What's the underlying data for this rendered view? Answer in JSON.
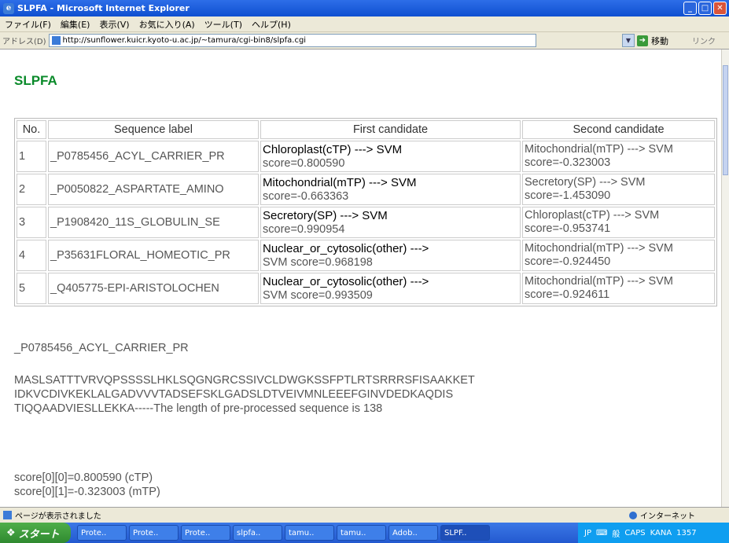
{
  "window": {
    "title": "SLPFA - Microsoft Internet Explorer",
    "controls": [
      "minimize",
      "maximize",
      "close"
    ]
  },
  "menubar": {
    "items": [
      "ファイル(F)",
      "編集(E)",
      "表示(V)",
      "お気に入り(A)",
      "ツール(T)",
      "ヘルプ(H)"
    ]
  },
  "addressbar": {
    "label": "アドレス(D)",
    "url": "http://sunflower.kuicr.kyoto-u.ac.jp/~tamura/cgi-bin8/slpfa.cgi",
    "go_label": "移動",
    "links_label": "リンク"
  },
  "page": {
    "title": "SLPFA",
    "table": {
      "headers": [
        "No.",
        "Sequence label",
        "First candidate",
        "Second candidate"
      ],
      "rows": [
        {
          "no": "1",
          "label": "_P0785456_ACYL_CARRIER_PR",
          "first_class": "Chloroplast(cTP) ---> SVM",
          "first_score": "score=0.800590",
          "second_class": "Mitochondrial(mTP) ---> SVM",
          "second_score": "score=-0.323003"
        },
        {
          "no": "2",
          "label": "_P0050822_ASPARTATE_AMINO",
          "first_class": "Mitochondrial(mTP) ---> SVM",
          "first_score": "score=-0.663363",
          "second_class": "Secretory(SP) ---> SVM",
          "second_score": "score=-1.453090"
        },
        {
          "no": "3",
          "label": "_P1908420_11S_GLOBULIN_SE",
          "first_class": "Secretory(SP) ---> SVM",
          "first_score": "score=0.990954",
          "second_class": "Chloroplast(cTP) ---> SVM",
          "second_score": "score=-0.953741"
        },
        {
          "no": "4",
          "label": "_P35631FLORAL_HOMEOTIC_PR",
          "first_class": "Nuclear_or_cytosolic(other) --->",
          "first_score": "SVM score=0.968198",
          "second_class": "Mitochondrial(mTP) ---> SVM",
          "second_score": "score=-0.924450"
        },
        {
          "no": "5",
          "label": "_Q405775-EPI-ARISTOLOCHEN",
          "first_class": "Nuclear_or_cytosolic(other) --->",
          "first_score": "SVM score=0.993509",
          "second_class": "Mitochondrial(mTP) ---> SVM",
          "second_score": "score=-0.924611"
        }
      ]
    },
    "detail": {
      "label": "_P0785456_ACYL_CARRIER_PR",
      "sequence_lines": [
        "MASLSATTTVRVQPSSSSLHKLSQGNGRCSSIVCLDWGKSSFPTLRTSRRRSFISAAKKET",
        "IDKVCDIVKEKLALGADVVVTADSEFSKLGADSLDTVEIVMNLEEEFGINVDEDKAQDIS",
        "TIQQAADVIESLLEKKA-----The length of pre-processed sequence is 138"
      ],
      "scores": [
        "score[0][0]=0.800590 (cTP)",
        "score[0][1]=-0.323003 (mTP)"
      ]
    }
  },
  "statusbar": {
    "text": "ページが表示されました",
    "zone": "インターネット"
  },
  "taskbar": {
    "start_label": "スタート",
    "tasks": [
      "Prote..",
      "Prote..",
      "Prote..",
      "slpfa..",
      "tamu..",
      "tamu..",
      "Adob..",
      "SLPF.."
    ],
    "ime": "JP",
    "ime_mode": "般",
    "caps": "CAPS",
    "kana": "KANA",
    "clock": "1357"
  }
}
